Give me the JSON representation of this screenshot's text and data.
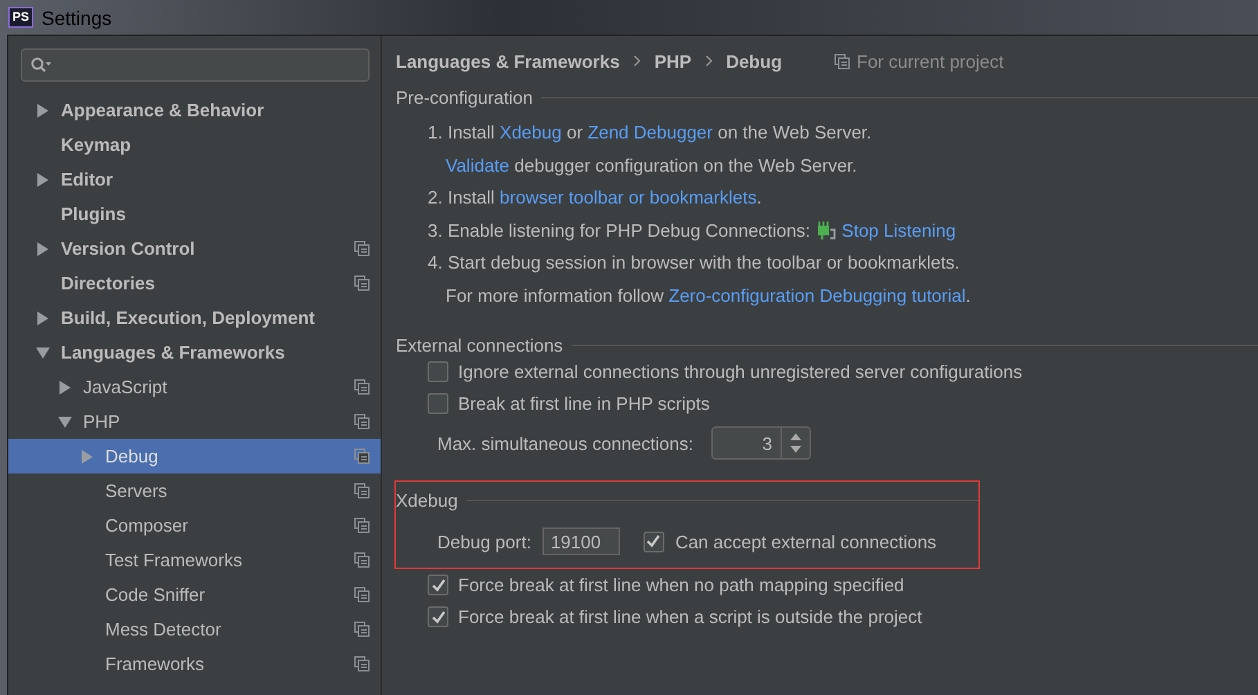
{
  "window": {
    "title": "Settings",
    "app_badge": "PS"
  },
  "sidebar": {
    "items": [
      {
        "label": "Appearance & Behavior",
        "expanded": false,
        "project_scope": false,
        "selected": false
      },
      {
        "label": "Keymap",
        "project_scope": false,
        "selected": false
      },
      {
        "label": "Editor",
        "expanded": false,
        "project_scope": false,
        "selected": false
      },
      {
        "label": "Plugins",
        "project_scope": false,
        "selected": false
      },
      {
        "label": "Version Control",
        "expanded": false,
        "project_scope": true,
        "selected": false
      },
      {
        "label": "Directories",
        "project_scope": true,
        "selected": false
      },
      {
        "label": "Build, Execution, Deployment",
        "expanded": false,
        "project_scope": false,
        "selected": false
      },
      {
        "label": "Languages & Frameworks",
        "expanded": true,
        "project_scope": false,
        "selected": false,
        "children": [
          {
            "label": "JavaScript",
            "expanded": false,
            "project_scope": true,
            "selected": false
          },
          {
            "label": "PHP",
            "expanded": true,
            "project_scope": true,
            "selected": false,
            "children": [
              {
                "label": "Debug",
                "expanded": false,
                "project_scope": true,
                "selected": true
              },
              {
                "label": "Servers",
                "project_scope": true,
                "selected": false
              },
              {
                "label": "Composer",
                "project_scope": true,
                "selected": false
              },
              {
                "label": "Test Frameworks",
                "project_scope": true,
                "selected": false
              },
              {
                "label": "Code Sniffer",
                "project_scope": true,
                "selected": false
              },
              {
                "label": "Mess Detector",
                "project_scope": true,
                "selected": false
              },
              {
                "label": "Frameworks",
                "project_scope": true,
                "selected": false
              }
            ]
          }
        ]
      }
    ]
  },
  "breadcrumb": [
    "Languages & Frameworks",
    "PHP",
    "Debug"
  ],
  "scope_note": "For current project",
  "pre_configuration": {
    "title": "Pre-configuration",
    "lines": [
      {
        "indent": false,
        "parts": [
          {
            "kind": "text",
            "text": "1. Install "
          },
          {
            "kind": "link",
            "text": "Xdebug"
          },
          {
            "kind": "text",
            "text": " or "
          },
          {
            "kind": "link",
            "text": "Zend Debugger"
          },
          {
            "kind": "text",
            "text": " on the Web Server."
          }
        ]
      },
      {
        "indent": true,
        "parts": [
          {
            "kind": "link",
            "text": "Validate"
          },
          {
            "kind": "text",
            "text": " debugger configuration on the Web Server."
          }
        ]
      },
      {
        "indent": false,
        "parts": [
          {
            "kind": "text",
            "text": "2. Install "
          },
          {
            "kind": "link",
            "text": "browser toolbar or bookmarklets"
          },
          {
            "kind": "text",
            "text": "."
          }
        ]
      },
      {
        "indent": false,
        "parts": [
          {
            "kind": "text",
            "text": "3. Enable listening for PHP Debug Connections: "
          },
          {
            "kind": "action",
            "text": "Stop Listening"
          }
        ]
      },
      {
        "indent": false,
        "parts": [
          {
            "kind": "text",
            "text": "4. Start debug session in browser with the toolbar or bookmarklets."
          }
        ]
      },
      {
        "indent": true,
        "parts": [
          {
            "kind": "text",
            "text": "For more information follow "
          },
          {
            "kind": "link",
            "text": "Zero-configuration Debugging tutorial"
          },
          {
            "kind": "text",
            "text": "."
          }
        ]
      }
    ]
  },
  "external_connections": {
    "title": "External connections",
    "options": [
      {
        "label": "Ignore external connections through unregistered server configurations",
        "checked": false
      },
      {
        "label": "Break at first line in PHP scripts",
        "checked": false
      }
    ],
    "max_connections": {
      "label": "Max. simultaneous connections:",
      "value": "3"
    }
  },
  "xdebug": {
    "title": "Xdebug",
    "highlighted": true,
    "port": {
      "label": "Debug port:",
      "value": "19100"
    },
    "accept_external": {
      "label": "Can accept external connections",
      "checked": true
    }
  },
  "force_break": [
    {
      "label": "Force break at first line when no path mapping specified",
      "checked": true
    },
    {
      "label": "Force break at first line when a script is outside the project",
      "checked": true
    }
  ]
}
